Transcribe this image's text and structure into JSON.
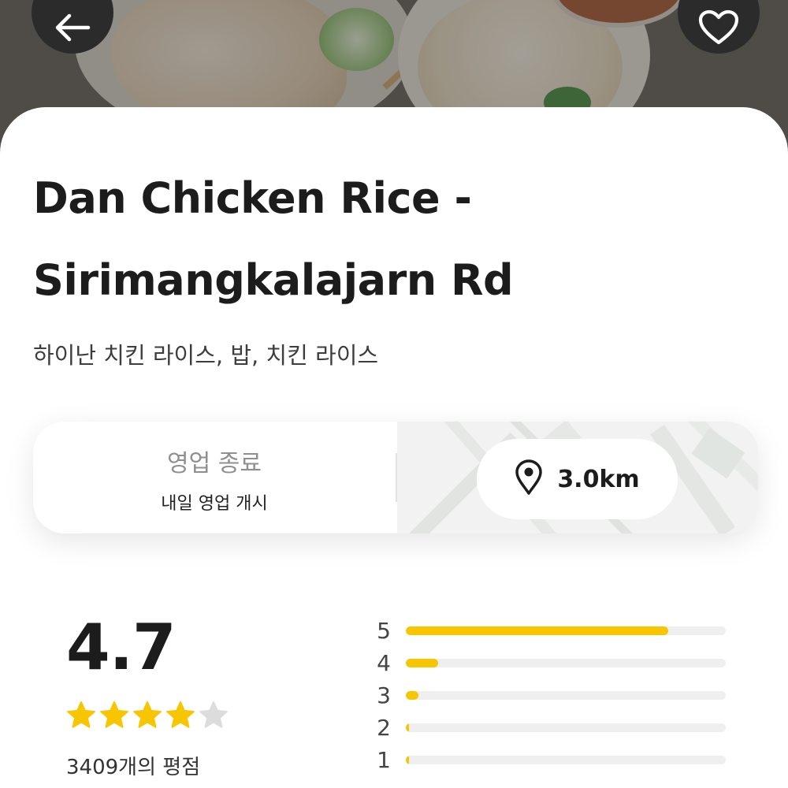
{
  "restaurant": {
    "name_line1": "Dan Chicken Rice -",
    "name_line2": "Sirimangkalajarn Rd",
    "categories": "하이난 치킨 라이스, 밥, 치킨 라이스"
  },
  "status": {
    "main": "영업 종료",
    "sub": "내일 영업 개시"
  },
  "distance": {
    "value": "3.0km",
    "icon": "location-pin-icon"
  },
  "rating": {
    "value": "4.7",
    "stars_filled": 4,
    "stars_total": 5,
    "count_text": "3409개의 평점",
    "distribution": [
      {
        "label": "5",
        "fraction": 0.82
      },
      {
        "label": "4",
        "fraction": 0.1
      },
      {
        "label": "3",
        "fraction": 0.04
      },
      {
        "label": "2",
        "fraction": 0.01
      },
      {
        "label": "1",
        "fraction": 0.01
      }
    ]
  },
  "icons": {
    "back": "back-arrow-icon",
    "favorite": "heart-icon"
  },
  "colors": {
    "accent": "#F7C600",
    "star_empty": "#DCDCDC",
    "button_dark": "#2B2B2B",
    "text_primary": "#1C1C1C"
  }
}
